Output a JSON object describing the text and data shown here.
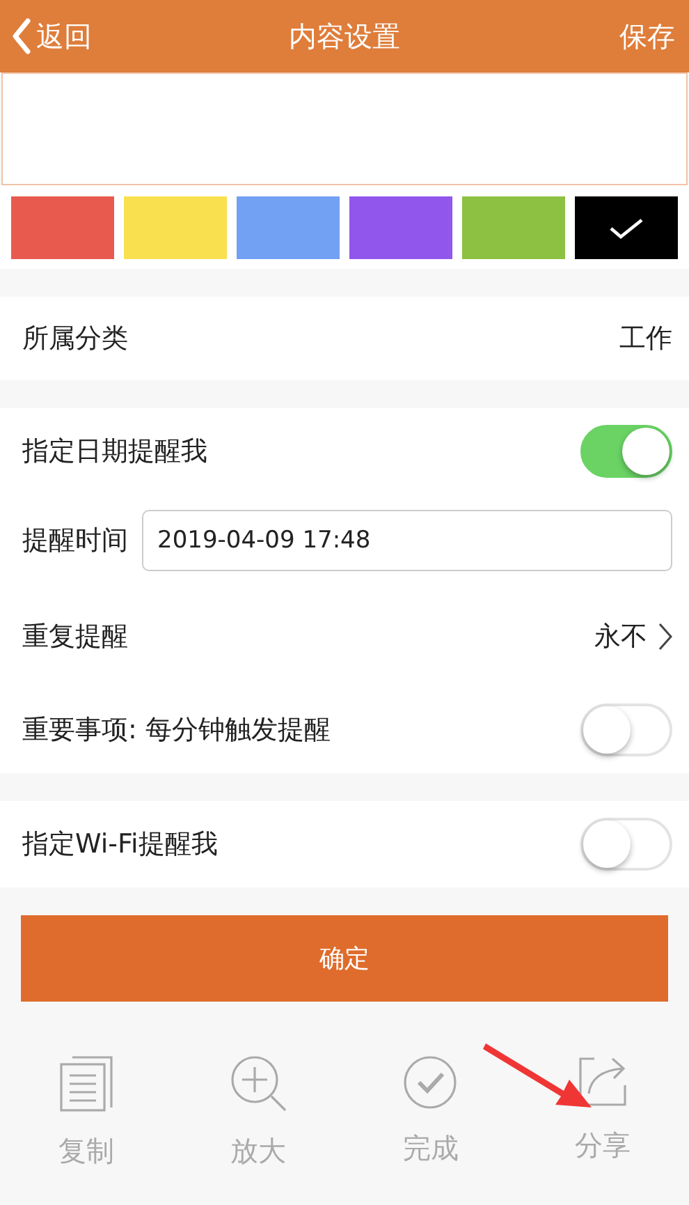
{
  "header": {
    "back": "返回",
    "title": "内容设置",
    "save": "保存"
  },
  "colors": [
    {
      "color": "#e95a4e",
      "selected": false
    },
    {
      "color": "#f9e04f",
      "selected": false
    },
    {
      "color": "#72a0f3",
      "selected": false
    },
    {
      "color": "#9156ec",
      "selected": false
    },
    {
      "color": "#8dc142",
      "selected": false
    },
    {
      "color": "#000000",
      "selected": true
    }
  ],
  "category": {
    "label": "所属分类",
    "value": "工作"
  },
  "reminder": [
    {
      "kind": "toggle",
      "label": "指定日期提醒我",
      "on": true
    },
    {
      "kind": "field",
      "label": "提醒时间",
      "value": "2019-04-09 17:48"
    },
    {
      "kind": "link",
      "label": "重复提醒",
      "value": "永不"
    },
    {
      "kind": "toggle",
      "label": "重要事项: 每分钟触发提醒",
      "on": false
    }
  ],
  "wifi": {
    "label": "指定Wi-Fi提醒我",
    "on": false
  },
  "confirm": "确定",
  "toolbar": [
    {
      "kind": "copy",
      "label": "复制"
    },
    {
      "kind": "zoom",
      "label": "放大"
    },
    {
      "kind": "done",
      "label": "完成"
    },
    {
      "kind": "share",
      "label": "分享"
    }
  ]
}
